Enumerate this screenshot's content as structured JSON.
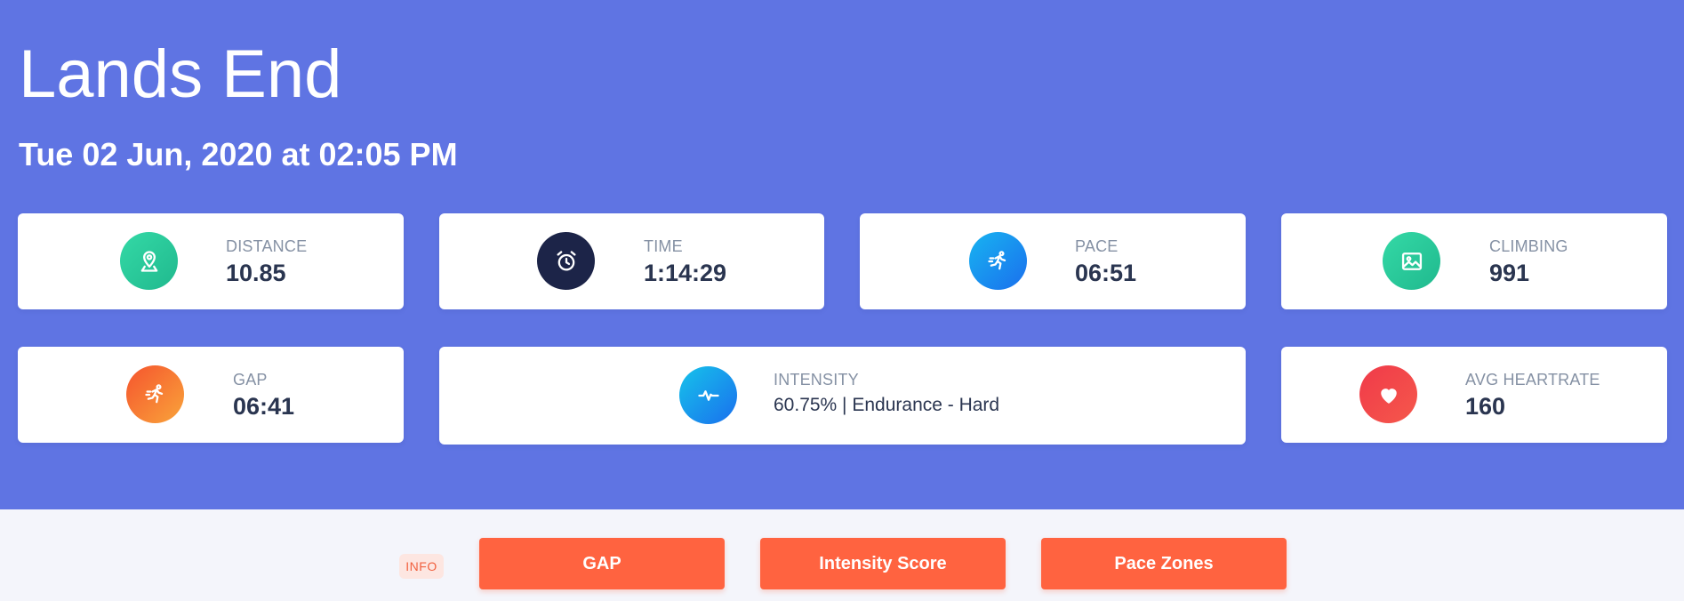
{
  "header": {
    "title": "Lands End",
    "subtitle": "Tue 02 Jun, 2020 at 02:05 PM"
  },
  "stats": {
    "distance": {
      "label": "DISTANCE",
      "value": "10.85",
      "icon": "map-marker-icon",
      "color": "#2ecfa0"
    },
    "time": {
      "label": "TIME",
      "value": "1:14:29",
      "icon": "alarm-clock-icon",
      "color": "#1c2448"
    },
    "pace": {
      "label": "PACE",
      "value": "06:51",
      "icon": "runner-icon",
      "color": "#1a8ff0"
    },
    "climbing": {
      "label": "CLIMBING",
      "value": "991",
      "icon": "image-icon",
      "color": "#2ecfa0"
    },
    "gap": {
      "label": "GAP",
      "value": "06:41",
      "icon": "runner-icon",
      "color": "#f7732f"
    },
    "intensity": {
      "label": "INTENSITY",
      "value": "60.75% | Endurance - Hard",
      "icon": "activity-pulse-icon",
      "color": "#1aa5ee"
    },
    "heartrate": {
      "label": "AVG HEARTRATE",
      "value": "160",
      "icon": "heart-icon",
      "color": "#f04148"
    }
  },
  "toolbar": {
    "info_label": "INFO",
    "buttons": [
      "GAP",
      "Intensity Score",
      "Pace Zones"
    ]
  },
  "colors": {
    "hero_background": "#5f74e3",
    "button": "#ff6340",
    "page_background": "#f4f5fb"
  }
}
